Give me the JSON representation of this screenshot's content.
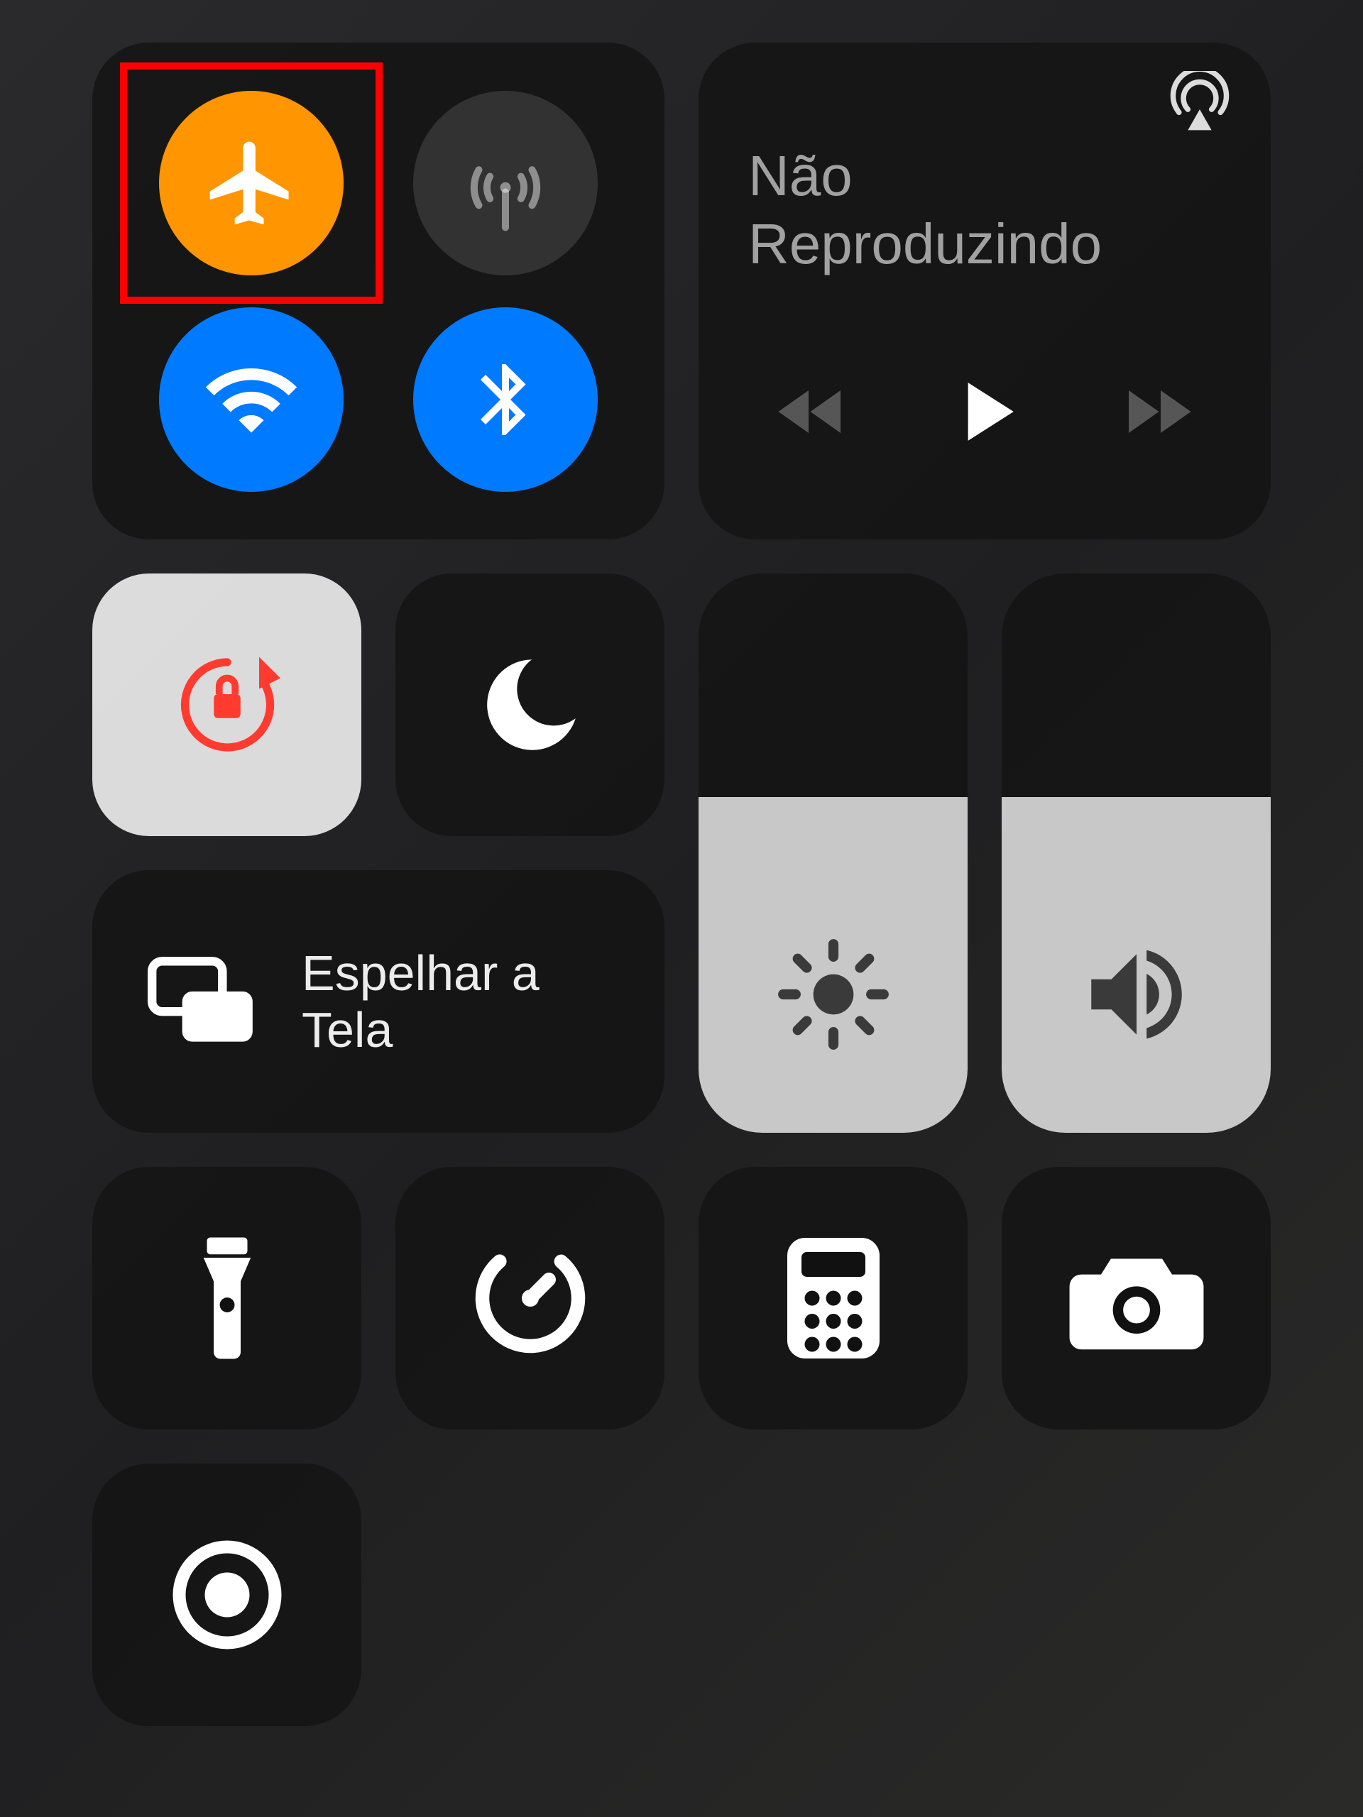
{
  "connectivity": {
    "airplane_mode": {
      "active": true,
      "color": "#ff9500",
      "highlighted": true
    },
    "cellular": {
      "active": false,
      "color": "rgba(255,255,255,0.12)"
    },
    "wifi": {
      "active": true,
      "color": "#007aff"
    },
    "bluetooth": {
      "active": true,
      "color": "#007aff"
    }
  },
  "media": {
    "title": "Não Reproduzindo",
    "playing": false
  },
  "tiles": {
    "orientation_lock": {
      "active": true,
      "icon_color": "#ff3b30",
      "tile_style": "light"
    },
    "do_not_disturb": {
      "active": false
    },
    "screen_mirroring": {
      "label": "Espelhar a Tela"
    },
    "flashlight": {
      "active": false
    },
    "timer": {
      "active": false
    },
    "calculator": {
      "active": false
    },
    "camera": {
      "active": false
    },
    "screen_record": {
      "active": false
    }
  },
  "sliders": {
    "brightness": {
      "value_percent": 60
    },
    "volume": {
      "value_percent": 60
    }
  }
}
